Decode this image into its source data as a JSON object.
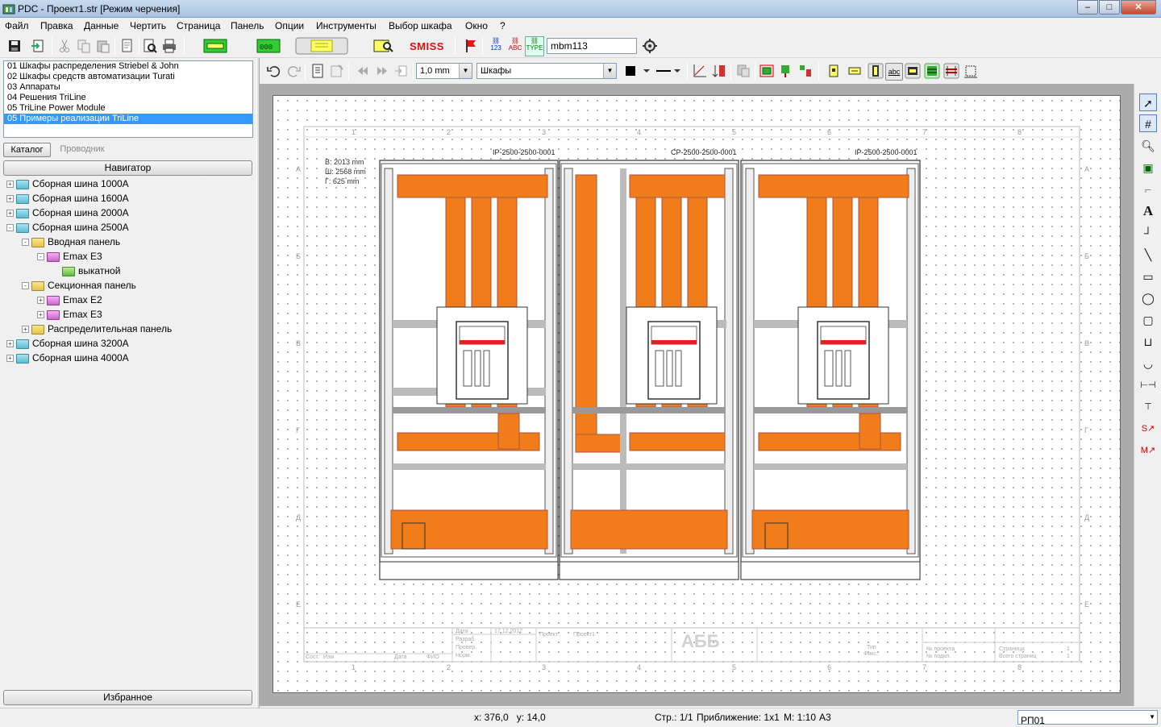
{
  "window": {
    "title": "PDC - Проект1.str [Режим черчения]"
  },
  "menu": [
    "Файл",
    "Правка",
    "Данные",
    "Чертить",
    "Страница",
    "Панель",
    "Опции",
    "Инструменты",
    "Выбор шкафа",
    "Окно",
    "?"
  ],
  "toolbar1": {
    "smiss_label": "SMISS",
    "search_value": "mbm113",
    "abc_label": "ABC",
    "num_label": "123",
    "type_label": "TYPE"
  },
  "catalogs": [
    "01 Шкафы распределения Striebel & John",
    "02 Шкафы средств автоматизации Turati",
    "03 Аппараты",
    "04 Решения TriLine",
    "05 TriLine Power Module",
    "05 Примеры реализации TriLine"
  ],
  "selected_catalog_index": 5,
  "tabs": {
    "catalog": "Каталог",
    "explorer": "Проводник"
  },
  "navigator_label": "Навигатор",
  "favorites_label": "Избранное",
  "tree": [
    {
      "label": "Сборная шина 1000A",
      "level": 0,
      "icon": "teal",
      "toggle": "+"
    },
    {
      "label": "Сборная шина 1600A",
      "level": 0,
      "icon": "teal",
      "toggle": "+"
    },
    {
      "label": "Сборная шина 2000A",
      "level": 0,
      "icon": "teal",
      "toggle": "+"
    },
    {
      "label": "Сборная шина 2500A",
      "level": 0,
      "icon": "teal",
      "toggle": "-"
    },
    {
      "label": "Вводная панель",
      "level": 1,
      "icon": "yellow",
      "toggle": "-"
    },
    {
      "label": "Emax E3",
      "level": 2,
      "icon": "pink",
      "toggle": "-"
    },
    {
      "label": "выкатной",
      "level": 3,
      "icon": "green",
      "toggle": ""
    },
    {
      "label": "Секционная панель",
      "level": 1,
      "icon": "yellow",
      "toggle": "-"
    },
    {
      "label": "Emax E2",
      "level": 2,
      "icon": "pink",
      "toggle": "+"
    },
    {
      "label": "Emax E3",
      "level": 2,
      "icon": "pink",
      "toggle": "+"
    },
    {
      "label": "Распределительная панель",
      "level": 1,
      "icon": "yellow",
      "toggle": "+"
    },
    {
      "label": "Сборная шина 3200A",
      "level": 0,
      "icon": "teal",
      "toggle": "+"
    },
    {
      "label": "Сборная шина 4000A",
      "level": 0,
      "icon": "teal",
      "toggle": "+"
    }
  ],
  "toolbar2": {
    "line_width": "1,0 mm",
    "layer": "Шкафы",
    "abc_label": "abc"
  },
  "drawing": {
    "dimensions": [
      "В: 2013 mm",
      "Ш: 2568 mm",
      "Г: 625 mm"
    ],
    "panel_labels": [
      "IP-2500-2500-0001",
      "CP-2500-2500-0001",
      "IP-2500-2500-0001"
    ],
    "column_numbers": [
      "1",
      "2",
      "3",
      "4",
      "5",
      "6",
      "7",
      "8"
    ],
    "row_letters": [
      "А",
      "Б",
      "В",
      "Г",
      "Д",
      "Е"
    ],
    "title_block_logo": "АББ",
    "title_block_cells": [
      "Дата",
      "17.12.2012",
      "Проект",
      "Проект1",
      "Разраб.",
      "Провер.",
      "Норм.",
      "Сост.",
      "Изм",
      "Дата",
      "ФИО",
      "Тип",
      "Фикс.",
      "№ проекта",
      "№ подкл.",
      "Страница",
      "1",
      "Всего страниц",
      "1"
    ]
  },
  "colors": {
    "busbar": "#f07d19",
    "frame": "#555555",
    "sheet_bg": "#ffffff",
    "canvas_bg": "#ababab"
  },
  "right_tools": [
    "arrow-icon",
    "grid-icon",
    "zoom-icon",
    "insert-icon",
    "line-step-icon",
    "text-icon",
    "polyline-icon",
    "line-icon",
    "rectangle-icon",
    "circle-icon",
    "rounded-rect-icon",
    "open-rect-icon",
    "arc-icon",
    "dim-horizontal-icon",
    "dim-vertical-icon",
    "symbol-s-icon",
    "symbol-m-icon"
  ],
  "status": {
    "coords": "x: 376,0   y: 14,0",
    "page": "Стр.: 1/1",
    "zoom": "Приближение: 1x1",
    "scale": "М: 1:10",
    "format": "А3",
    "panel_select": "РП01"
  }
}
